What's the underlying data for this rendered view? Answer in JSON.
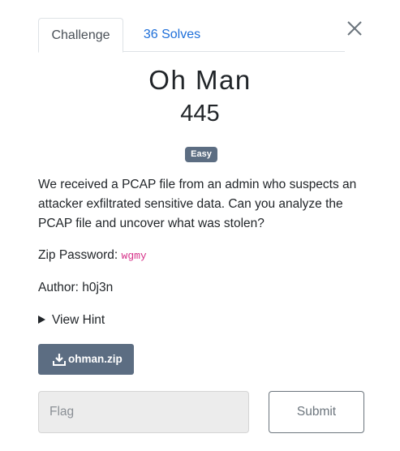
{
  "modal": {
    "close_icon": "close-icon"
  },
  "tabs": [
    {
      "label": "Challenge",
      "active": true
    },
    {
      "label": "36 Solves",
      "active": false
    }
  ],
  "challenge": {
    "name": "Oh Man",
    "points": "445",
    "difficulty": "Easy",
    "description": "We received a PCAP file from an admin who suspects an attacker exfiltrated sensitive data. Can you analyze the PCAP file and uncover what was stolen?",
    "zip_password_label": "Zip Password: ",
    "zip_password": "wgmy",
    "author": "Author: h0j3n",
    "hint_label": "View Hint",
    "file_name": "ohman.zip"
  },
  "form": {
    "flag_placeholder": "Flag",
    "submit_label": "Submit"
  },
  "colors": {
    "badge": "#5c6d82",
    "link": "#1e6fd9",
    "code": "#d6338a"
  }
}
